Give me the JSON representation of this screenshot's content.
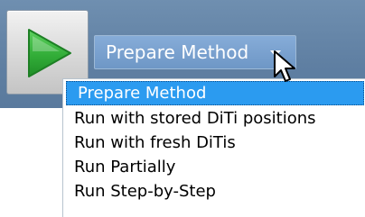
{
  "toolbar": {
    "run_icon": "play-icon",
    "method_select": {
      "value": "Prepare Method",
      "icon": "chevron-down-icon"
    }
  },
  "dropdown": {
    "items": [
      {
        "label": "Prepare Method",
        "selected": true
      },
      {
        "label": "Run with stored DiTi positions",
        "selected": false
      },
      {
        "label": "Run with fresh DiTis",
        "selected": false
      },
      {
        "label": "Run Partially",
        "selected": false
      },
      {
        "label": "Run Step-by-Step",
        "selected": false
      }
    ]
  },
  "colors": {
    "toolbar_bg": "#6384a8",
    "select_bg": "#7aa3d1",
    "selection_bg": "#2b9bf0",
    "play_green": "#35b23c"
  }
}
